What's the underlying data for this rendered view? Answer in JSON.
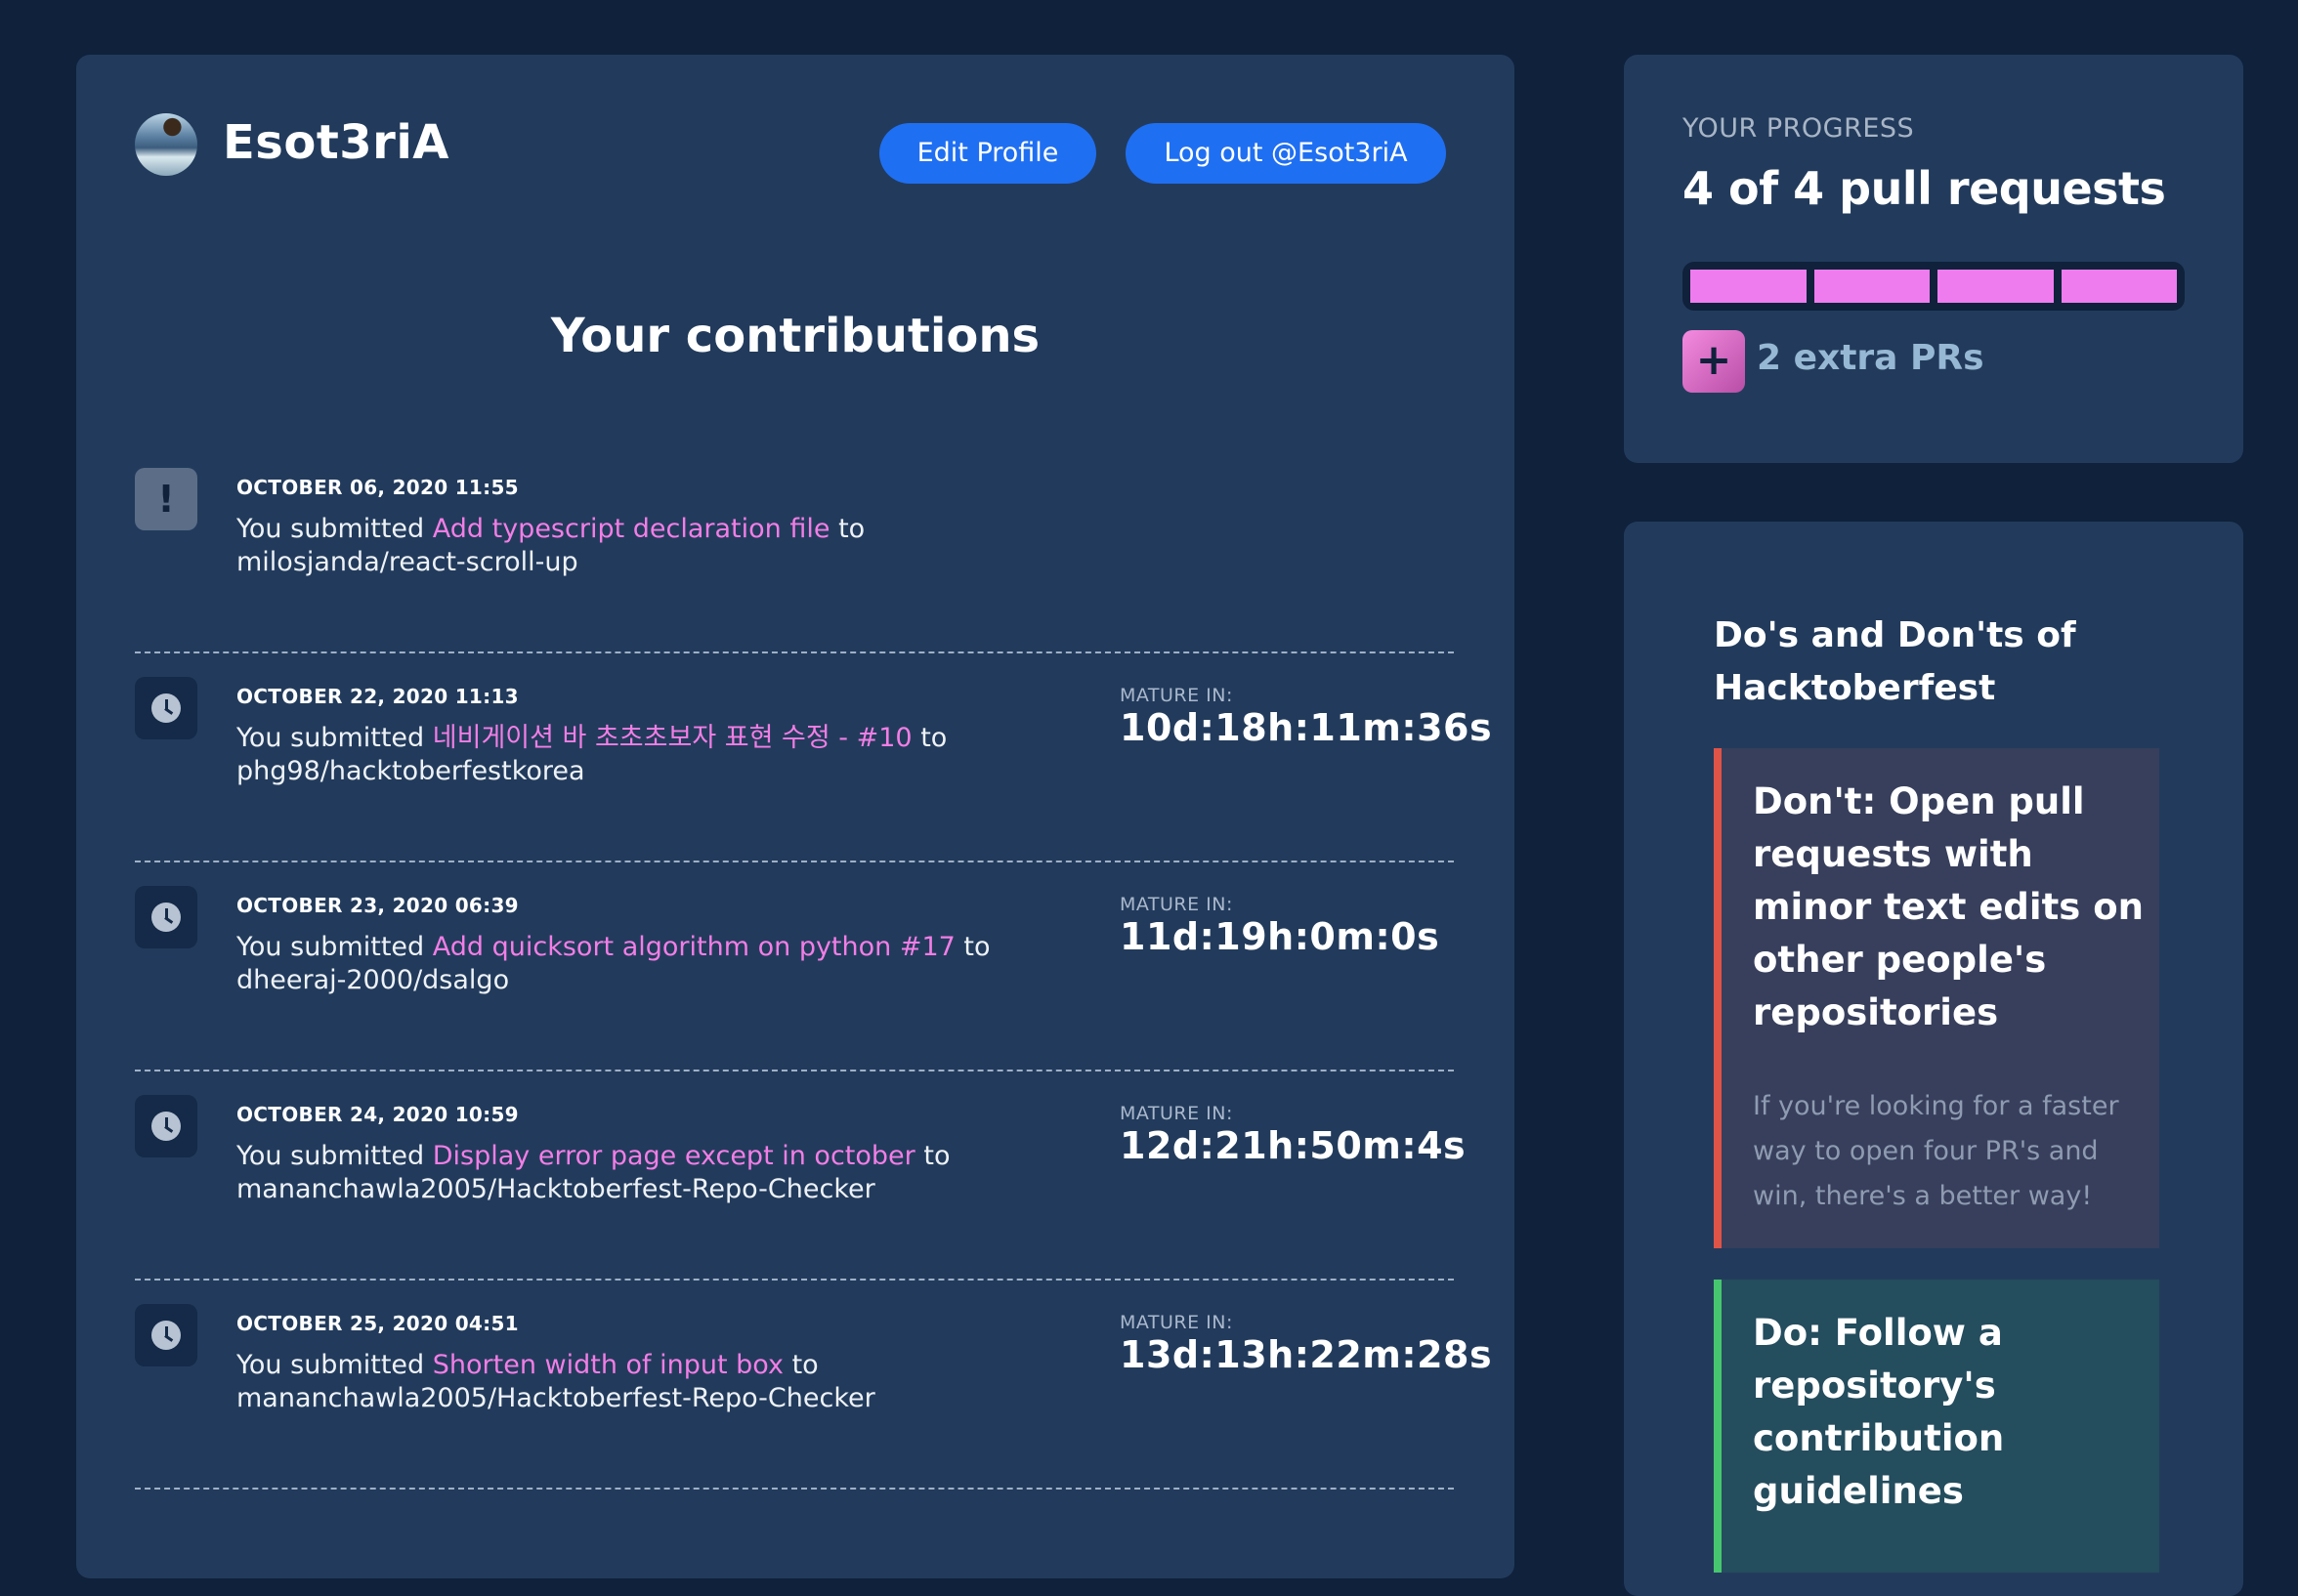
{
  "header": {
    "username": "Esot3riA",
    "edit_profile_label": "Edit Profile",
    "logout_label": "Log out @Esot3riA"
  },
  "contributions": {
    "title": "Your contributions",
    "mature_label": "MATURE IN:",
    "submitted_prefix": "You submitted",
    "to_word": "to",
    "items": [
      {
        "status_icon": "alert-icon",
        "date": "OCTOBER 06, 2020 11:55",
        "title": "Add typescript declaration file",
        "repo": "milosjanda/react-scroll-up",
        "mature_in": ""
      },
      {
        "status_icon": "clock-icon",
        "date": "OCTOBER 22, 2020 11:13",
        "title": "네비게이션 바 초초초보자 표현 수정 - #10",
        "repo": "phg98/hacktoberfestkorea",
        "mature_in": "10d:18h:11m:36s"
      },
      {
        "status_icon": "clock-icon",
        "date": "OCTOBER 23, 2020 06:39",
        "title": "Add quicksort algorithm on python #17",
        "repo": "dheeraj-2000/dsalgo",
        "mature_in": "11d:19h:0m:0s"
      },
      {
        "status_icon": "clock-icon",
        "date": "OCTOBER 24, 2020 10:59",
        "title": "Display error page except in october",
        "repo": "mananchawla2005/Hacktoberfest-Repo-Checker",
        "mature_in": "12d:21h:50m:4s"
      },
      {
        "status_icon": "clock-icon",
        "date": "OCTOBER 25, 2020 04:51",
        "title": "Shorten width of input box",
        "repo": "mananchawla2005/Hacktoberfest-Repo-Checker",
        "mature_in": "13d:13h:22m:28s"
      }
    ]
  },
  "progress": {
    "label": "YOUR PROGRESS",
    "count_text": "4 of 4 pull requests",
    "completed": 4,
    "total": 4,
    "extra_icon": "+",
    "extra_text": "2 extra PRs",
    "bar_color": "#ee7cee"
  },
  "tips": {
    "title": "Do's and Don'ts of Hacktoberfest",
    "dont": {
      "heading": "Don't: Open pull requests with minor text edits on other people's repositories",
      "body": "If you're looking for a faster way to open four PR's and win, there's a better way!",
      "accent": "#e05347"
    },
    "do": {
      "heading": "Do: Follow a repository's contribution guidelines",
      "accent": "#46c66f"
    }
  }
}
